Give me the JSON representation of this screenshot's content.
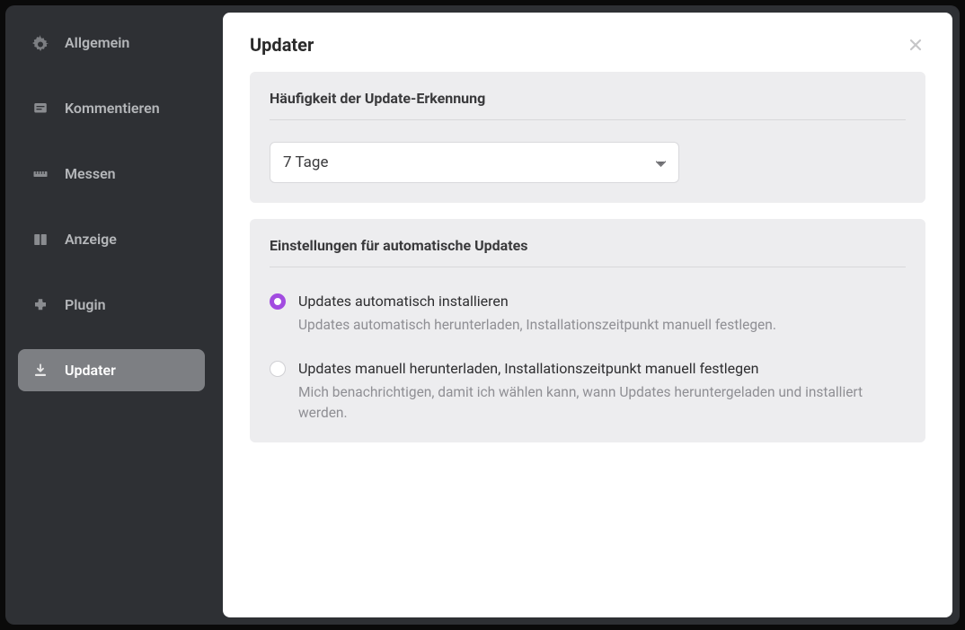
{
  "sidebar": {
    "items": [
      {
        "label": "Allgemein"
      },
      {
        "label": "Kommentieren"
      },
      {
        "label": "Messen"
      },
      {
        "label": "Anzeige"
      },
      {
        "label": "Plugin"
      },
      {
        "label": "Updater"
      }
    ],
    "active_index": 5
  },
  "panel": {
    "title": "Updater"
  },
  "sections": {
    "frequency": {
      "title": "Häufigkeit der Update-Erkennung",
      "selected_value": "7 Tage"
    },
    "auto_update": {
      "title": "Einstellungen für automatische Updates",
      "options": [
        {
          "label": "Updates automatisch installieren",
          "description": "Updates automatisch herunterladen, Installationszeitpunkt manuell festlegen.",
          "selected": true
        },
        {
          "label": "Updates manuell herunterladen, Installationszeitpunkt manuell festlegen",
          "description": "Mich benachrichtigen, damit ich wählen kann, wann Updates heruntergeladen und installiert werden.",
          "selected": false
        }
      ]
    }
  }
}
